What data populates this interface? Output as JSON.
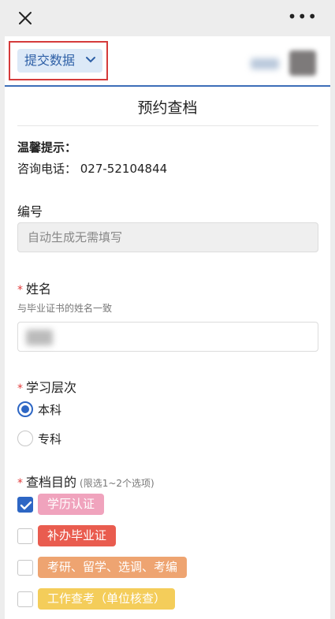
{
  "topbar": {
    "close_icon": "close-icon",
    "more_label": "•••"
  },
  "header": {
    "submit_label": "提交数据",
    "submit_icon": "chevron-down-icon"
  },
  "form": {
    "title": "预约查档",
    "tip_heading": "温馨提示：",
    "tip_phone": "咨询电话： 027-52104844",
    "fields": {
      "number": {
        "label": "编号",
        "placeholder": "自动生成无需填写"
      },
      "name": {
        "label": "姓名",
        "hint": "与毕业证书的姓名一致",
        "required_mark": "*"
      },
      "level": {
        "label": "学习层次",
        "required_mark": "*",
        "options": [
          {
            "label": "本科",
            "selected": true
          },
          {
            "label": "专科",
            "selected": false
          }
        ]
      },
      "purpose": {
        "label": "查档目的",
        "sub": "(限选1~2个选项)",
        "required_mark": "*",
        "options": [
          {
            "label": "学历认证",
            "checked": true,
            "color": "#f0a3bd"
          },
          {
            "label": "补办毕业证",
            "checked": false,
            "color": "#e95c4f"
          },
          {
            "label": "考研、留学、选调、考编",
            "checked": false,
            "color": "#eea471"
          },
          {
            "label": "工作查考（单位核查）",
            "checked": false,
            "color": "#f4cd5a"
          }
        ]
      }
    }
  },
  "colors": {
    "accent": "#2d66c4",
    "highlight_box": "#d53b3b",
    "required": "#e23b3b"
  }
}
